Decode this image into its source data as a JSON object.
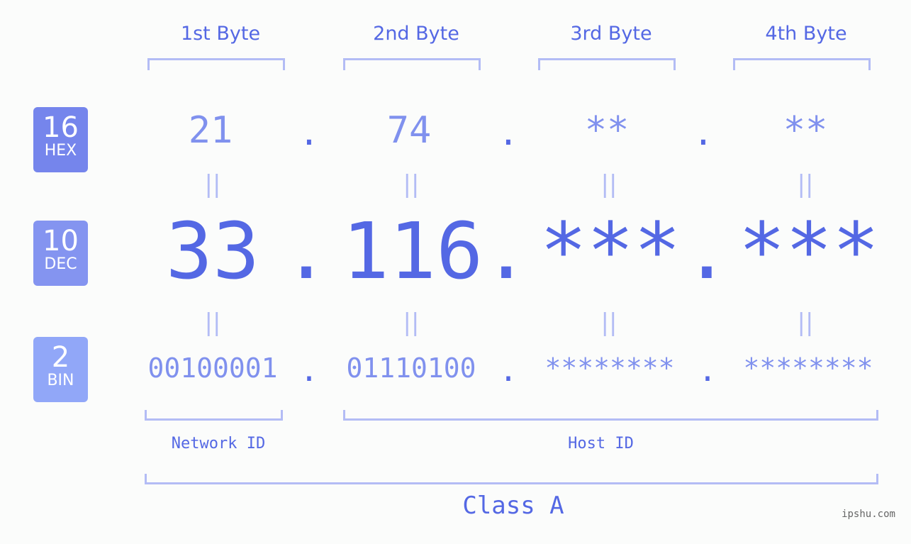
{
  "bytes": [
    {
      "header": "1st Byte",
      "hex": "21",
      "dec": "33",
      "bin": "00100001"
    },
    {
      "header": "2nd Byte",
      "hex": "74",
      "dec": "116",
      "bin": "01110100"
    },
    {
      "header": "3rd Byte",
      "hex": "**",
      "dec": "***",
      "bin": "********"
    },
    {
      "header": "4th Byte",
      "hex": "**",
      "dec": "***",
      "bin": "********"
    }
  ],
  "separator": ".",
  "equals": "||",
  "badges": {
    "hex": {
      "number": "16",
      "label": "HEX",
      "color": "#7585ec"
    },
    "dec": {
      "number": "10",
      "label": "DEC",
      "color": "#8494f0"
    },
    "bin": {
      "number": "2",
      "label": "BIN",
      "color": "#91a7f8"
    }
  },
  "labels": {
    "network_id": "Network ID",
    "host_id": "Host ID",
    "class": "Class A"
  },
  "watermark": "ipshu.com",
  "colors": {
    "primary": "#5468e4",
    "light": "#8091ee",
    "bracket": "#b3bcf5"
  }
}
